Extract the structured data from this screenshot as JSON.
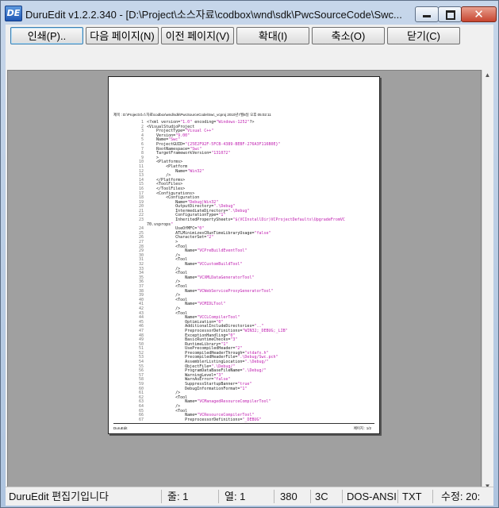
{
  "window": {
    "icon_label": "DE",
    "title": "DuruEdit v1.2.2.340 - [D:\\Project\\소스자료\\codbox\\wnd\\sdk\\PwcSourceCode\\Swc...",
    "close_glyph": "✕"
  },
  "toolbar": {
    "print": "인쇄(P)..",
    "next_page": "다음 페이지(N)",
    "prev_page": "이전 페이지(V)",
    "zoom_in": "확대(I)",
    "zoom_out": "축소(O)",
    "close": "닫기(C)"
  },
  "preview": {
    "header": "제목 : D:\\Project\\소스자료\\codbox\\wnd\\sdk\\PwcSourceCode\\Swc_vcproj   2010년7월8일 오후 05:02:11",
    "footer_left": "DuruEdit",
    "footer_right": "페이지 : 1/2",
    "lines": [
      {
        "n": "1",
        "t": "<?xml version=\"1.0\" encoding=\"Windows-1252\"?>"
      },
      {
        "n": "2",
        "t": "<VisualStudioProject"
      },
      {
        "n": "3",
        "t": "    ProjectType=\"Visual C++\""
      },
      {
        "n": "4",
        "t": "    Version=\"9.00\""
      },
      {
        "n": "5",
        "t": "    Name=\"Swc\""
      },
      {
        "n": "6",
        "t": "    ProjectGUID=\"{25E2F92F-5FCB-4389-BEBF-276A3F116B0E}\""
      },
      {
        "n": "7",
        "t": "    RootNamespace=\"Swc\""
      },
      {
        "n": "8",
        "t": "    TargetFrameworkVersion=\"131072\""
      },
      {
        "n": "9",
        "t": "    >"
      },
      {
        "n": "10",
        "t": "    <Platforms>"
      },
      {
        "n": "11",
        "t": "        <Platform"
      },
      {
        "n": "12",
        "t": "            Name=\"Win32\""
      },
      {
        "n": "13",
        "t": "        />"
      },
      {
        "n": "14",
        "t": "    </Platforms>"
      },
      {
        "n": "15",
        "t": "    <ToolFiles>"
      },
      {
        "n": "16",
        "t": "    </ToolFiles>"
      },
      {
        "n": "17",
        "t": "    <Configurations>"
      },
      {
        "n": "18",
        "t": "        <Configuration"
      },
      {
        "n": "19",
        "t": "            Name=\"Debug|Win32\""
      },
      {
        "n": "20",
        "t": "            OutputDirectory=\".\\Debug\""
      },
      {
        "n": "21",
        "t": "            IntermediateDirectory=\".\\Debug\""
      },
      {
        "n": "22",
        "t": "            ConfigurationType=\"1\""
      },
      {
        "n": "23",
        "t": "            InheritedPropertySheets=\"$(VCInstallDir)VCProjectDefaults\\UpgradeFromVC"
      },
      {
        "n": "",
        "t": "70.vsprops\""
      },
      {
        "n": "24",
        "t": "            UseOfMFC=\"0\""
      },
      {
        "n": "25",
        "t": "            ATLMinimizesCRunTimeLibraryUsage=\"false\""
      },
      {
        "n": "26",
        "t": "            CharacterSet=\"2\""
      },
      {
        "n": "27",
        "t": "            >"
      },
      {
        "n": "28",
        "t": "            <Tool"
      },
      {
        "n": "29",
        "t": "                Name=\"VCPreBuildEventTool\""
      },
      {
        "n": "30",
        "t": "            />"
      },
      {
        "n": "31",
        "t": "            <Tool"
      },
      {
        "n": "32",
        "t": "                Name=\"VCCustomBuildTool\""
      },
      {
        "n": "33",
        "t": "            />"
      },
      {
        "n": "34",
        "t": "            <Tool"
      },
      {
        "n": "35",
        "t": "                Name=\"VCXMLDataGeneratorTool\""
      },
      {
        "n": "36",
        "t": "            />"
      },
      {
        "n": "37",
        "t": "            <Tool"
      },
      {
        "n": "38",
        "t": "                Name=\"VCWebServiceProxyGeneratorTool\""
      },
      {
        "n": "39",
        "t": "            />"
      },
      {
        "n": "40",
        "t": "            <Tool"
      },
      {
        "n": "41",
        "t": "                Name=\"VCMIDLTool\""
      },
      {
        "n": "42",
        "t": "            />"
      },
      {
        "n": "43",
        "t": "            <Tool"
      },
      {
        "n": "44",
        "t": "                Name=\"VCCLCompilerTool\""
      },
      {
        "n": "45",
        "t": "                Optimization=\"0\""
      },
      {
        "n": "46",
        "t": "                AdditionalIncludeDirectories=\"..\""
      },
      {
        "n": "47",
        "t": "                PreprocessorDefinitions=\"WIN32;_DEBUG;_LIB\""
      },
      {
        "n": "48",
        "t": "                ExceptionHandling=\"0\""
      },
      {
        "n": "49",
        "t": "                BasicRuntimeChecks=\"3\""
      },
      {
        "n": "50",
        "t": "                RuntimeLibrary=\"1\""
      },
      {
        "n": "51",
        "t": "                UsePrecompiledHeader=\"2\""
      },
      {
        "n": "52",
        "t": "                PrecompiledHeaderThrough=\"stdafx.h\""
      },
      {
        "n": "53",
        "t": "                PrecompiledHeaderFile=\".\\Debug/Swc.pch\""
      },
      {
        "n": "54",
        "t": "                AssemblerListingLocation=\".\\Debug/\""
      },
      {
        "n": "55",
        "t": "                ObjectFile=\".\\Debug/\""
      },
      {
        "n": "56",
        "t": "                ProgramDataBaseFileName=\".\\Debug/\""
      },
      {
        "n": "57",
        "t": "                WarningLevel=\"3\""
      },
      {
        "n": "58",
        "t": "                WarnAsError=\"false\""
      },
      {
        "n": "59",
        "t": "                SuppressStartupBanner=\"true\""
      },
      {
        "n": "60",
        "t": "                DebugInformationFormat=\"1\""
      },
      {
        "n": "61",
        "t": "            />"
      },
      {
        "n": "62",
        "t": "            <Tool"
      },
      {
        "n": "63",
        "t": "                Name=\"VCManagedResourceCompilerTool\""
      },
      {
        "n": "64",
        "t": "            />"
      },
      {
        "n": "65",
        "t": "            <Tool"
      },
      {
        "n": "66",
        "t": "                Name=\"VCResourceCompilerTool\""
      },
      {
        "n": "67",
        "t": "                PreprocessorDefinitions=\"_DEBUG\""
      }
    ]
  },
  "statusbar": {
    "message": "DuruEdit 편집기입니다",
    "line": "줄: 1",
    "column": "열: 1",
    "size": "380",
    "code": "3C",
    "encoding": "DOS-ANSI",
    "filetype": "TXT",
    "modified": "수정: 20:"
  }
}
